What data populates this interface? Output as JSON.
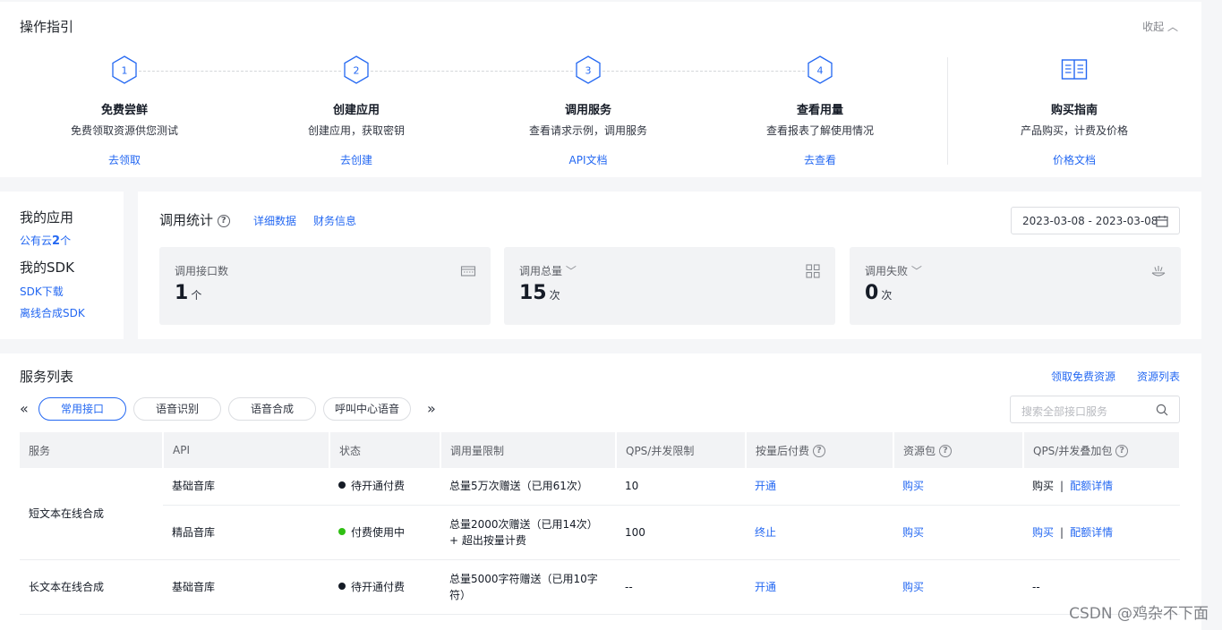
{
  "guide": {
    "title": "操作指引",
    "collapse": "收起",
    "steps": [
      {
        "num": "1",
        "title": "免费尝鲜",
        "desc": "免费领取资源供您测试",
        "link": "去领取"
      },
      {
        "num": "2",
        "title": "创建应用",
        "desc": "创建应用，获取密钥",
        "link": "去创建"
      },
      {
        "num": "3",
        "title": "调用服务",
        "desc": "查看请求示例，调用服务",
        "link": "API文档"
      },
      {
        "num": "4",
        "title": "查看用量",
        "desc": "查看报表了解使用情况",
        "link": "去查看"
      }
    ],
    "buy": {
      "title": "购买指南",
      "desc": "产品购买，计费及价格",
      "link": "价格文档",
      "icon": "book-icon"
    }
  },
  "myapp": {
    "apps_title": "我的应用",
    "public_cloud_prefix": "公有云",
    "public_cloud_count": "2",
    "public_cloud_suffix": "个",
    "sdk_title": "我的SDK",
    "sdk_download": "SDK下载",
    "offline_sdk": "离线合成SDK"
  },
  "stats": {
    "title": "调用统计",
    "detail_link": "详细数据",
    "finance_link": "财务信息",
    "date_range": "2023-03-08 - 2023-03-08",
    "cards": [
      {
        "label": "调用接口数",
        "value": "1",
        "unit": "个",
        "icon": "keyboard-icon"
      },
      {
        "label": "调用总量",
        "value": "15",
        "unit": "次",
        "icon": "grid-icon"
      },
      {
        "label": "调用失败",
        "value": "0",
        "unit": "次",
        "icon": "fail-icon"
      }
    ]
  },
  "services": {
    "title": "服务列表",
    "free_link": "领取免费资源",
    "resource_link": "资源列表",
    "tabs": [
      "常用接口",
      "语音识别",
      "语音合成",
      "呼叫中心语音"
    ],
    "search_placeholder": "搜索全部接口服务",
    "columns": [
      "服务",
      "API",
      "状态",
      "调用量限制",
      "QPS/并发限制",
      "按量后付费",
      "资源包",
      "QPS/并发叠加包"
    ],
    "rows": [
      {
        "service": "短文本在线合成",
        "api": "基础音库",
        "status": "待开通付费",
        "status_color": "#151b26",
        "limit": "总量5万次赠送（已用61次）",
        "qps": "10",
        "postpaid": "开通",
        "package": "购买",
        "qps_pkg_buy": "购买",
        "qps_pkg_detail": "配额详情"
      },
      {
        "service": "",
        "api": "精品音库",
        "status": "付费使用中",
        "status_color": "#30bf13",
        "limit": "总量2000次赠送（已用14次） + 超出按量计费",
        "qps": "100",
        "postpaid": "终止",
        "package": "购买",
        "qps_pkg_buy": "购买",
        "qps_pkg_detail": "配额详情"
      },
      {
        "service": "长文本在线合成",
        "api": "基础音库",
        "status": "待开通付费",
        "status_color": "#151b26",
        "limit": "总量5000字符赠送（已用10字符）",
        "qps": "--",
        "postpaid": "开通",
        "package": "购买",
        "qps_pkg_dash": "--"
      }
    ]
  },
  "watermark": "CSDN @鸡杂不下面"
}
